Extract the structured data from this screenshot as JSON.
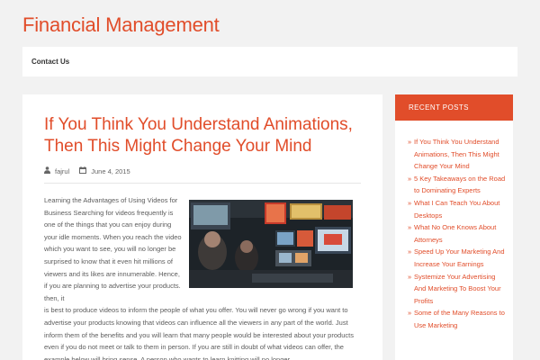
{
  "site": {
    "title": "Financial Management"
  },
  "nav": {
    "items": [
      {
        "label": "Contact Us"
      }
    ]
  },
  "post": {
    "title": "If You Think You Understand Animations, Then This Might Change Your Mind",
    "author": "fajrul",
    "date": "June 4, 2015",
    "paragraph_wrapped": "Learning the Advantages of Using Videos for Business Searching for videos frequently is one of the things that you can enjoy during your idle moments. When you reach the video which you want to see, you will no longer be surprised to know that it even hit millions of viewers and its likes are innumerable. Hence, if you are planning to advertise your products. then, it",
    "paragraph_full": "is best to produce videos to inform the people of what you offer. You will never go wrong if you want to advertise your products knowing that videos can influence all the viewers in any part of the world. Just inform them of the benefits and you will learn that many people would be interested about your products even if you do not meet or talk to them in person. If you are still in doubt of what videos can offer, the example below will bring sense. A person who wants to learn knitting will no longer"
  },
  "icons": {
    "author": "user-icon",
    "date": "calendar-icon"
  },
  "colors": {
    "accent": "#e14d2a",
    "background": "#f2f2f2"
  },
  "sidebar": {
    "widget_title": "RECENT POSTS",
    "recent_posts": [
      "If You Think You Understand Animations, Then This Might Change Your Mind",
      "5 Key Takeaways on the Road to Dominating Experts",
      "What I Can Teach You About Desktops",
      "What No One Knows About Attorneys",
      "Speed Up Your Marketing And Increase Your Earnings",
      "Systemize Your Advertising And Marketing To Boost Your Profits",
      "Some of the Many Reasons to Use Marketing"
    ]
  }
}
